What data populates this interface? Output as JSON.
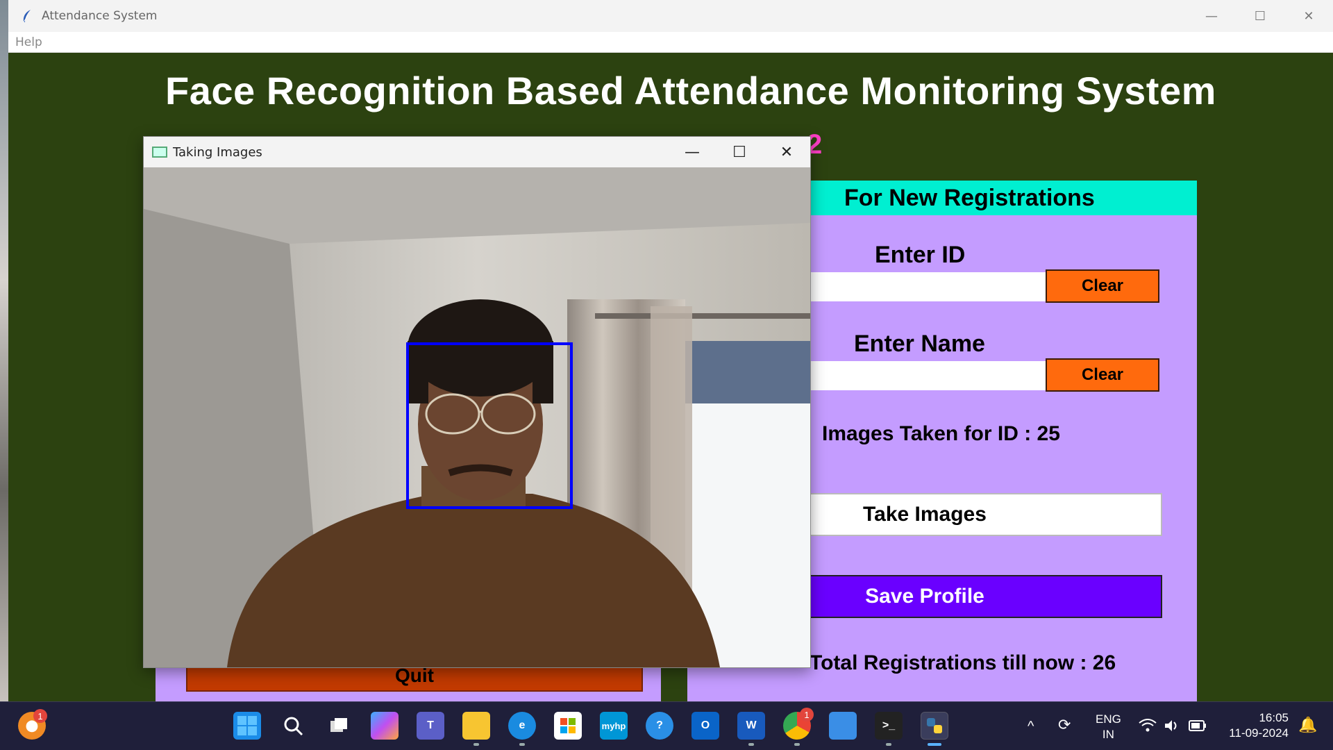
{
  "window": {
    "title": "Attendance System",
    "minimize": "—",
    "maximize": "☐",
    "close": "✕"
  },
  "menubar": {
    "help": "Help"
  },
  "heading": "Face Recognition Based Attendance Monitoring System",
  "date_partial": "2",
  "left_frame": {
    "quit_label": "Quit"
  },
  "registration": {
    "header": "For New Registrations",
    "enter_id_label": "Enter ID",
    "id_value": "",
    "clear_label": "Clear",
    "enter_name_label": "Enter Name",
    "name_value": "",
    "status": "Images Taken for ID : 25",
    "take_images_label": "Take Images",
    "save_profile_label": "Save Profile",
    "total_label": "Total Registrations till now  : 26"
  },
  "capture_window": {
    "title": "Taking Images",
    "minimize": "—",
    "maximize": "☐",
    "close": "✕"
  },
  "taskbar": {
    "notification_count": "1",
    "chrome_badge": "1",
    "language_top": "ENG",
    "language_bottom": "IN",
    "time": "16:05",
    "date": "11-09-2024",
    "icons": [
      "start-icon",
      "search-icon",
      "task-view-icon",
      "copilot-icon",
      "teams-icon",
      "file-explorer-icon",
      "edge-icon",
      "store-icon",
      "myhp-icon",
      "help-icon",
      "outlook-icon",
      "word-icon",
      "chrome-icon",
      "photos-icon",
      "terminal-icon",
      "python-icon"
    ]
  },
  "colors": {
    "background": "#2c4210",
    "panel": "#c49cff",
    "header": "#00efd1",
    "clear_button": "#ff6a0d",
    "save_button": "#6a00ff",
    "quit_button": "#c23a00",
    "face_box": "#0000ff",
    "date_text": "#ff3fc8"
  }
}
